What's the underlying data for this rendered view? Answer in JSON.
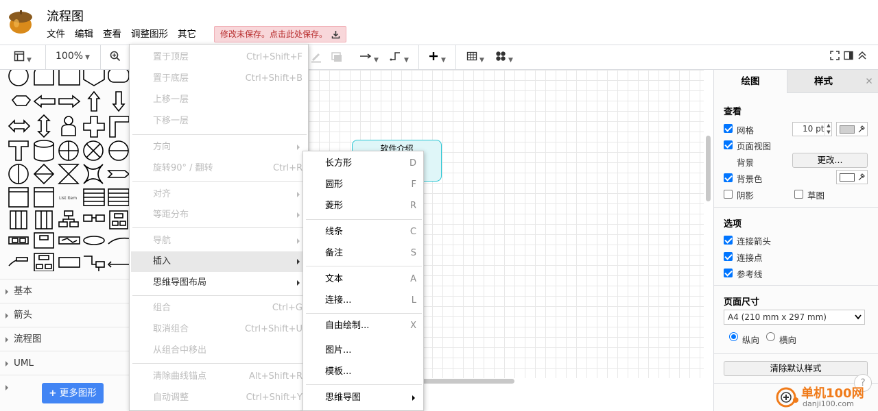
{
  "header": {
    "title": "流程图",
    "menus": [
      "文件",
      "编辑",
      "查看",
      "调整图形",
      "其它"
    ],
    "save_warning": "修改未保存。点击此处保存。"
  },
  "toolbar": {
    "zoom": "100%"
  },
  "sidebar": {
    "categories": [
      "基本",
      "箭头",
      "流程图",
      "UML"
    ],
    "more_shapes": "更多图形",
    "list_item_text": "List Item"
  },
  "canvas": {
    "node_label": "软件介绍"
  },
  "arrange_menu": {
    "items": [
      {
        "label": "置于顶层",
        "shortcut": "Ctrl+Shift+F"
      },
      {
        "label": "置于底层",
        "shortcut": "Ctrl+Shift+B"
      },
      {
        "label": "上移一层",
        "shortcut": ""
      },
      {
        "label": "下移一层",
        "shortcut": ""
      },
      {
        "label": "方向",
        "shortcut": ""
      },
      {
        "label": "旋转90° / 翻转",
        "shortcut": "Ctrl+R"
      },
      {
        "label": "对齐",
        "shortcut": ""
      },
      {
        "label": "等距分布",
        "shortcut": ""
      },
      {
        "label": "导航",
        "shortcut": ""
      },
      {
        "label": "插入",
        "shortcut": ""
      },
      {
        "label": "思维导图布局",
        "shortcut": ""
      },
      {
        "label": "组合",
        "shortcut": "Ctrl+G"
      },
      {
        "label": "取消组合",
        "shortcut": "Ctrl+Shift+U"
      },
      {
        "label": "从组合中移出",
        "shortcut": ""
      },
      {
        "label": "清除曲线锚点",
        "shortcut": "Alt+Shift+R"
      },
      {
        "label": "自动调整",
        "shortcut": "Ctrl+Shift+Y"
      }
    ]
  },
  "insert_menu": {
    "items": [
      {
        "label": "长方形",
        "shortcut": "D"
      },
      {
        "label": "圆形",
        "shortcut": "F"
      },
      {
        "label": "菱形",
        "shortcut": "R"
      },
      {
        "label": "线条",
        "shortcut": "C"
      },
      {
        "label": "备注",
        "shortcut": "S"
      },
      {
        "label": "文本",
        "shortcut": "A"
      },
      {
        "label": "连接...",
        "shortcut": "L"
      },
      {
        "label": "自由绘制...",
        "shortcut": "X"
      },
      {
        "label": "图片...",
        "shortcut": ""
      },
      {
        "label": "模板...",
        "shortcut": ""
      },
      {
        "label": "思维导图",
        "shortcut": ""
      }
    ]
  },
  "right_panel": {
    "tabs": [
      "绘图",
      "样式"
    ],
    "view_section": "查看",
    "grid_label": "网格",
    "grid_size": "10 pt",
    "page_view_label": "页面视图",
    "background_label": "背景",
    "change_button": "更改...",
    "bg_color_label": "背景色",
    "shadow_label": "阴影",
    "sketch_label": "草图",
    "options_section": "选项",
    "connection_arrows": "连接箭头",
    "connection_points": "连接点",
    "guides": "参考线",
    "page_size_section": "页面尺寸",
    "page_size_value": "A4 (210 mm x 297 mm)",
    "portrait": "纵向",
    "landscape": "横向",
    "clear_default_style": "清除默认样式"
  },
  "watermark": {
    "text1": "单机100网",
    "text2": "danji100.com"
  },
  "colors": {
    "accent": "#4285f4",
    "node_fill": "#dff6f8",
    "node_stroke": "#27c5d3",
    "warning_bg": "#f8d7da",
    "warning_text": "#b72c2c"
  }
}
